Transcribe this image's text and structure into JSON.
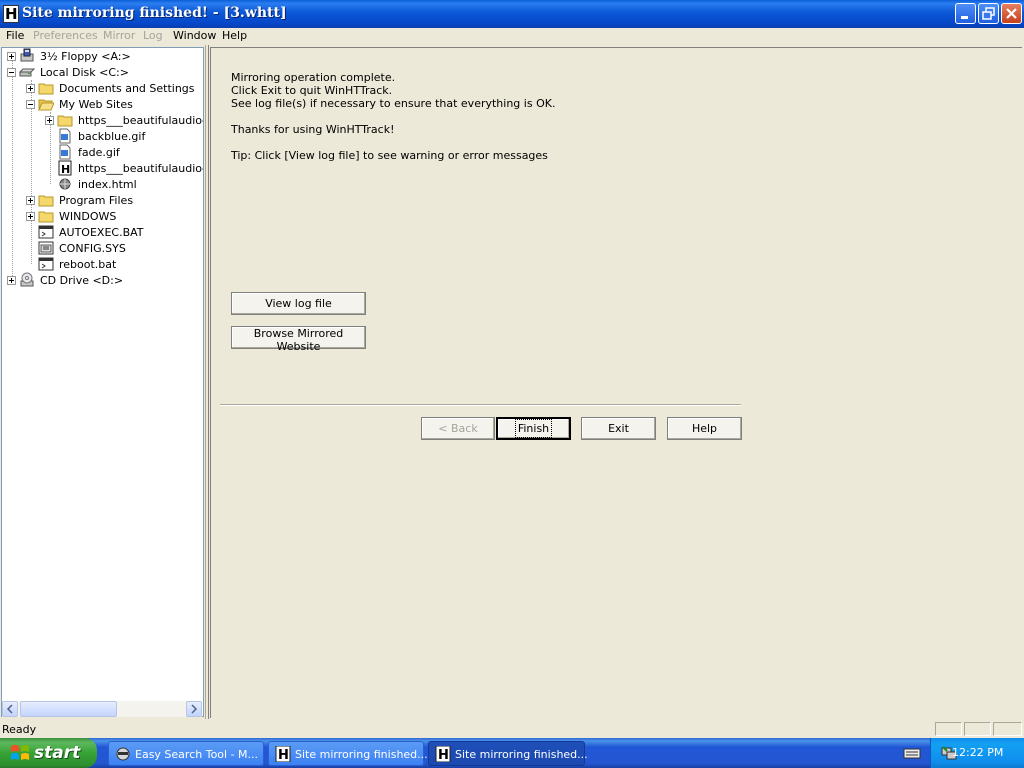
{
  "window": {
    "title": "Site mirroring finished! - [3.whtt]",
    "app_icon_letter": "H"
  },
  "menu": [
    "File",
    "Preferences",
    "Mirror",
    "Log",
    "Window",
    "Help"
  ],
  "menu_disabled": [
    "Preferences",
    "Mirror",
    "Log"
  ],
  "tree": {
    "items": [
      {
        "label": "3½ Floppy <A:>",
        "icon": "floppy-drive-icon",
        "level": 0,
        "expander": "plus"
      },
      {
        "label": "Local Disk <C:>",
        "icon": "hard-drive-icon",
        "level": 0,
        "expander": "minus"
      },
      {
        "label": "Documents and Settings",
        "icon": "folder-icon",
        "level": 1,
        "expander": "plus"
      },
      {
        "label": "My Web Sites",
        "icon": "folder-open-icon",
        "level": 1,
        "expander": "minus"
      },
      {
        "label": "https___beautifulaudioed",
        "icon": "folder-icon",
        "level": 2,
        "expander": "plus"
      },
      {
        "label": "backblue.gif",
        "icon": "gif-file-icon",
        "level": 2,
        "expander": ""
      },
      {
        "label": "fade.gif",
        "icon": "gif-file-icon",
        "level": 2,
        "expander": ""
      },
      {
        "label": "https___beautifulaudioed",
        "icon": "httrack-file-icon",
        "level": 2,
        "expander": ""
      },
      {
        "label": "index.html",
        "icon": "html-file-icon",
        "level": 2,
        "expander": ""
      },
      {
        "label": "Program Files",
        "icon": "folder-icon",
        "level": 1,
        "expander": "plus"
      },
      {
        "label": "WINDOWS",
        "icon": "folder-icon",
        "level": 1,
        "expander": "plus"
      },
      {
        "label": "AUTOEXEC.BAT",
        "icon": "bat-file-icon",
        "level": 1,
        "expander": ""
      },
      {
        "label": "CONFIG.SYS",
        "icon": "sys-file-icon",
        "level": 1,
        "expander": ""
      },
      {
        "label": "reboot.bat",
        "icon": "bat-file-icon",
        "level": 1,
        "expander": ""
      },
      {
        "label": "CD Drive <D:>",
        "icon": "cd-drive-icon",
        "level": 0,
        "expander": "plus"
      }
    ]
  },
  "main": {
    "messages": [
      "Mirroring operation complete.",
      "Click Exit to quit WinHTTrack.",
      "See log file(s) if necessary to ensure that everything is OK.",
      "Thanks for using WinHTTrack!",
      "Tip: Click [View log file] to see warning or error messages"
    ],
    "view_log_label": "View log file",
    "browse_label": "Browse Mirrored Website",
    "back_label": "< Back",
    "finish_label": "Finish",
    "exit_label": "Exit",
    "help_label": "Help"
  },
  "status": {
    "text": "Ready"
  },
  "taskbar": {
    "start_label": "start",
    "tasks": [
      {
        "label": "Easy Search Tool - M...",
        "active": false
      },
      {
        "label": "Site mirroring finished...",
        "active": false
      },
      {
        "label": "Site mirroring finished...",
        "active": true
      }
    ],
    "clock": "12:22 PM"
  },
  "colors": {
    "titlebar": "#0a58d6",
    "taskbar": "#2456d0",
    "start_button": "#36a336",
    "tray": "#0f8ded",
    "dialog_bg": "#ece9d8"
  }
}
